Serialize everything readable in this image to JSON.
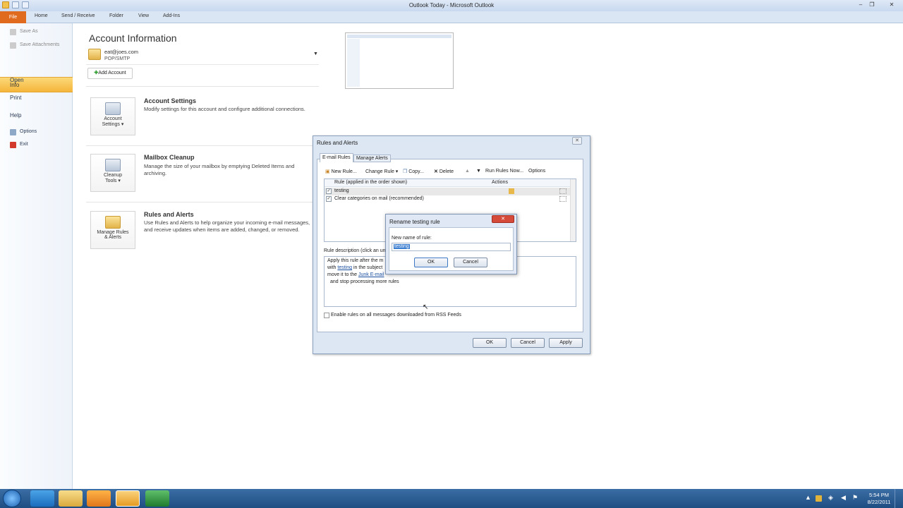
{
  "window": {
    "title": "Outlook Today - Microsoft Outlook",
    "minimize": "–",
    "maximize": "❐",
    "close": "✕"
  },
  "ribbon": {
    "tabs": [
      "File",
      "Home",
      "Send / Receive",
      "Folder",
      "View",
      "Add-Ins"
    ]
  },
  "backstage": {
    "save_as": "Save As",
    "save_attachments": "Save Attachments",
    "info": "Info",
    "open": "Open",
    "print": "Print",
    "help": "Help",
    "options": "Options",
    "exit": "Exit"
  },
  "account": {
    "title": "Account Information",
    "email": "eat@joes.com",
    "type": "POP/SMTP",
    "add_account": "Add Account",
    "sections": [
      {
        "button": "Account Settings ▾",
        "button_line1": "Account",
        "button_line2": "Settings ▾",
        "heading": "Account Settings",
        "desc": "Modify settings for this account and configure additional connections."
      },
      {
        "button_line1": "Cleanup",
        "button_line2": "Tools ▾",
        "heading": "Mailbox Cleanup",
        "desc": "Manage the size of your mailbox by emptying Deleted Items and archiving."
      },
      {
        "button_line1": "Manage Rules",
        "button_line2": "& Alerts",
        "heading": "Rules and Alerts",
        "desc": "Use Rules and Alerts to help organize your incoming e-mail messages, and receive updates when items are added, changed, or removed."
      }
    ]
  },
  "rules_dialog": {
    "title": "Rules and Alerts",
    "close": "✕",
    "tabs": [
      "E-mail Rules",
      "Manage Alerts"
    ],
    "toolbar": [
      "New Rule...",
      "Change Rule ▾",
      "Copy...",
      "Delete",
      "▲",
      "▼",
      "Run Rules Now...",
      "Options"
    ],
    "columns": [
      "Rule (applied in the order shown)",
      "Actions"
    ],
    "rules": [
      {
        "name": "testing",
        "checked": "✓"
      },
      {
        "name": "Clear categories on mail (recommended)",
        "checked": "✓"
      }
    ],
    "desc_label": "Rule description (click an un",
    "desc_lines": {
      "l1": "Apply this rule after the m",
      "l2a": "with ",
      "l2link": "testing",
      "l2b": " in the subject",
      "l3a": "move it to the ",
      "l3link": "Junk E-mail",
      "l4": "and stop processing more rules"
    },
    "rss_label": "Enable rules on all messages downloaded from RSS Feeds",
    "ok": "OK",
    "cancel": "Cancel",
    "apply": "Apply"
  },
  "rename_dialog": {
    "title": "Rename testing rule",
    "close": "✕",
    "label": "New name of rule:",
    "value": "testing",
    "ok": "OK",
    "cancel": "Cancel"
  },
  "taskbar": {
    "time": "5:54 PM",
    "date": "8/22/2011"
  }
}
